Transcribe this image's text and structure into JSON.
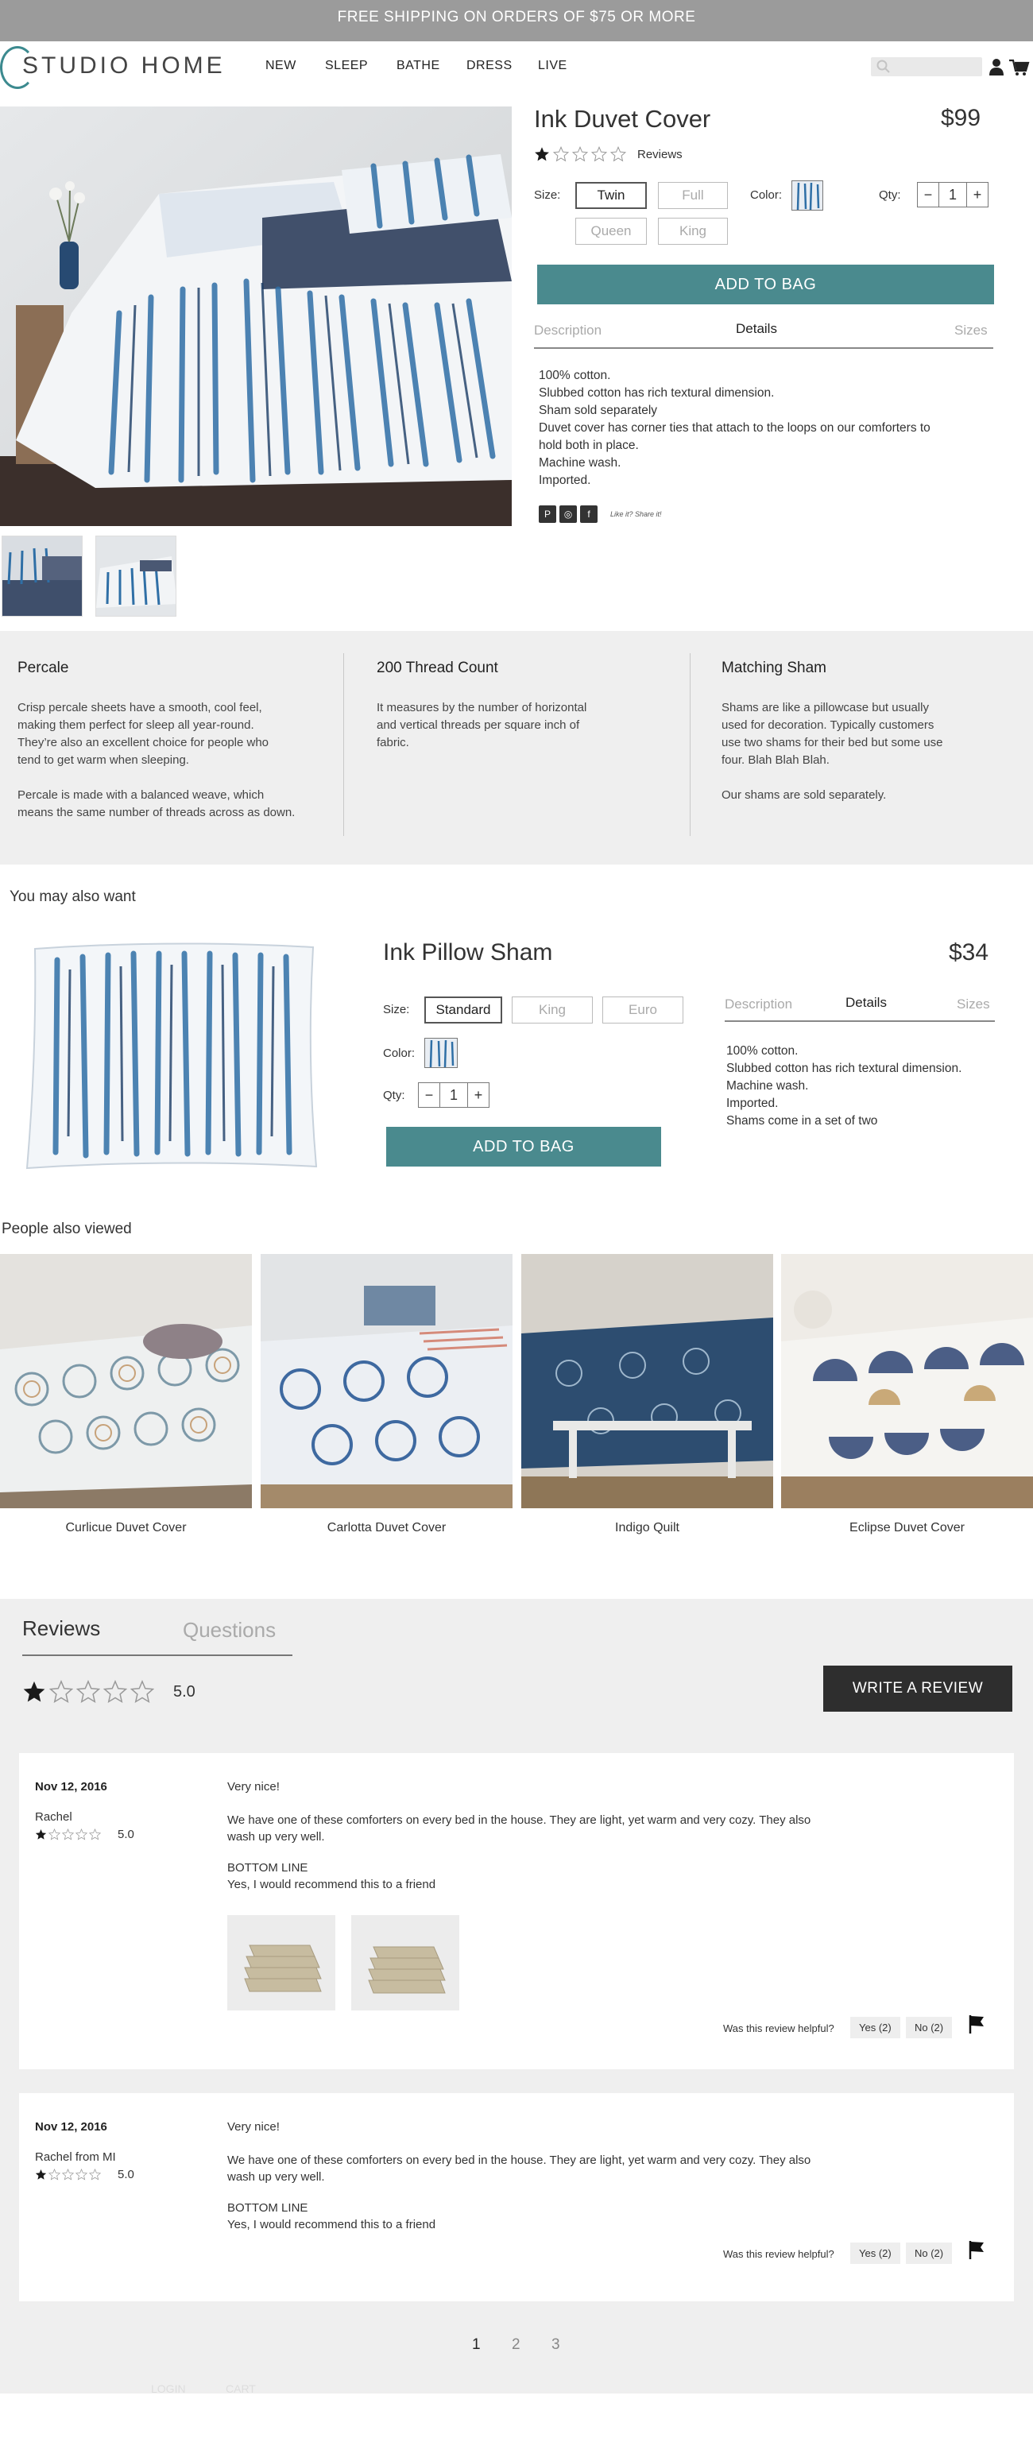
{
  "banner": {
    "text": "FREE SHIPPING ON ORDERS OF $75 OR MORE"
  },
  "header": {
    "logo": "STUDIO HOME",
    "nav": [
      "NEW",
      "SLEEP",
      "BATHE",
      "DRESS",
      "LIVE"
    ],
    "search_placeholder": ""
  },
  "product": {
    "title": "Ink Duvet Cover",
    "price": "$99",
    "rating": 1,
    "reviews_label": "Reviews",
    "size_label": "Size:",
    "sizes": [
      "Twin",
      "Full",
      "Queen",
      "King"
    ],
    "selected_size": "Twin",
    "color_label": "Color:",
    "qty_label": "Qty:",
    "qty_minus": "−",
    "qty_value": "1",
    "qty_plus": "+",
    "add_to_bag": "ADD TO BAG",
    "tabs": [
      "Description",
      "Details",
      "Sizes"
    ],
    "active_tab": "Details",
    "details": [
      "100% cotton.",
      "Slubbed cotton has rich textural dimension.",
      "Sham sold separately",
      "Duvet cover has corner ties that attach to the loops on our comforters to",
      "hold both in place.",
      "Machine wash.",
      "Imported."
    ],
    "share_label": "Like it? Share it!",
    "social": [
      "P",
      "◎",
      "f"
    ]
  },
  "features": [
    {
      "title": "Percale",
      "paragraphs": [
        [
          "Crisp percale sheets have a smooth, cool feel,",
          "making them perfect for sleep all year-round.",
          "They’re also an excellent choice for people who",
          "tend to get warm when sleeping."
        ],
        [
          "Percale is made with a balanced weave, which",
          "means the same number of threads across as down."
        ]
      ]
    },
    {
      "title": "200 Thread Count",
      "paragraphs": [
        [
          "It measures by the number of horizontal",
          "and vertical threads per square inch of",
          "fabric."
        ]
      ]
    },
    {
      "title": "Matching Sham",
      "paragraphs": [
        [
          "Shams are like a pillowcase but usually",
          "used for decoration. Typically customers",
          "use two shams for their bed but some use",
          "four. Blah Blah Blah."
        ],
        [
          "Our shams are sold separately."
        ]
      ]
    }
  ],
  "upsell": {
    "section_title": "You may also want",
    "title": "Ink Pillow Sham",
    "price": "$34",
    "size_label": "Size:",
    "sizes": [
      "Standard",
      "King",
      "Euro"
    ],
    "selected_size": "Standard",
    "color_label": "Color:",
    "qty_label": "Qty:",
    "qty_minus": "−",
    "qty_value": "1",
    "qty_plus": "+",
    "add_to_bag": "ADD TO BAG",
    "tabs": [
      "Description",
      "Details",
      "Sizes"
    ],
    "active_tab": "Details",
    "details": [
      "100% cotton.",
      "Slubbed cotton has rich textural dimension.",
      "Machine wash.",
      "Imported.",
      "Shams come in a set of two"
    ]
  },
  "also_viewed": {
    "section_title": "People also viewed",
    "items": [
      "Curlicue Duvet Cover",
      "Carlotta Duvet Cover",
      "Indigo Quilt",
      "Eclipse Duvet Cover"
    ]
  },
  "reviews": {
    "tabs": [
      "Reviews",
      "Questions"
    ],
    "active_tab": "Reviews",
    "average_rating": 1,
    "average_score": "5.0",
    "write_button": "WRITE A REVIEW",
    "helpful_label": "Was this review helpful?",
    "items": [
      {
        "date": "Nov 12, 2016",
        "name": "Rachel",
        "rating": 1,
        "score": "5.0",
        "title": "Very nice!",
        "body": [
          "We have one of these comforters on every bed in the house. They are light, yet warm and very cozy. They also",
          "wash up very well."
        ],
        "bottom_line_label": "BOTTOM LINE",
        "bottom_line": "Yes, I would recommend this to a friend",
        "yes": "Yes (2)",
        "no": "No (2)"
      },
      {
        "date": "Nov 12, 2016",
        "name": "Rachel from MI",
        "rating": 1,
        "score": "5.0",
        "title": "Very nice!",
        "body": [
          "We have one of these comforters on every bed in the house. They are light, yet warm and very cozy. They also",
          "wash up very well."
        ],
        "bottom_line_label": "BOTTOM LINE",
        "bottom_line": "Yes, I would recommend this to a friend",
        "yes": "Yes (2)",
        "no": "No (2)"
      }
    ],
    "pages": [
      "1",
      "2",
      "3"
    ],
    "current_page": "1"
  },
  "footer": {
    "links": [
      "LOGIN",
      "CART"
    ]
  },
  "colors": {
    "accent": "#4a8a8e",
    "banner": "#9b9b9b",
    "panel": "#efefef",
    "dark": "#2e2e2e"
  }
}
